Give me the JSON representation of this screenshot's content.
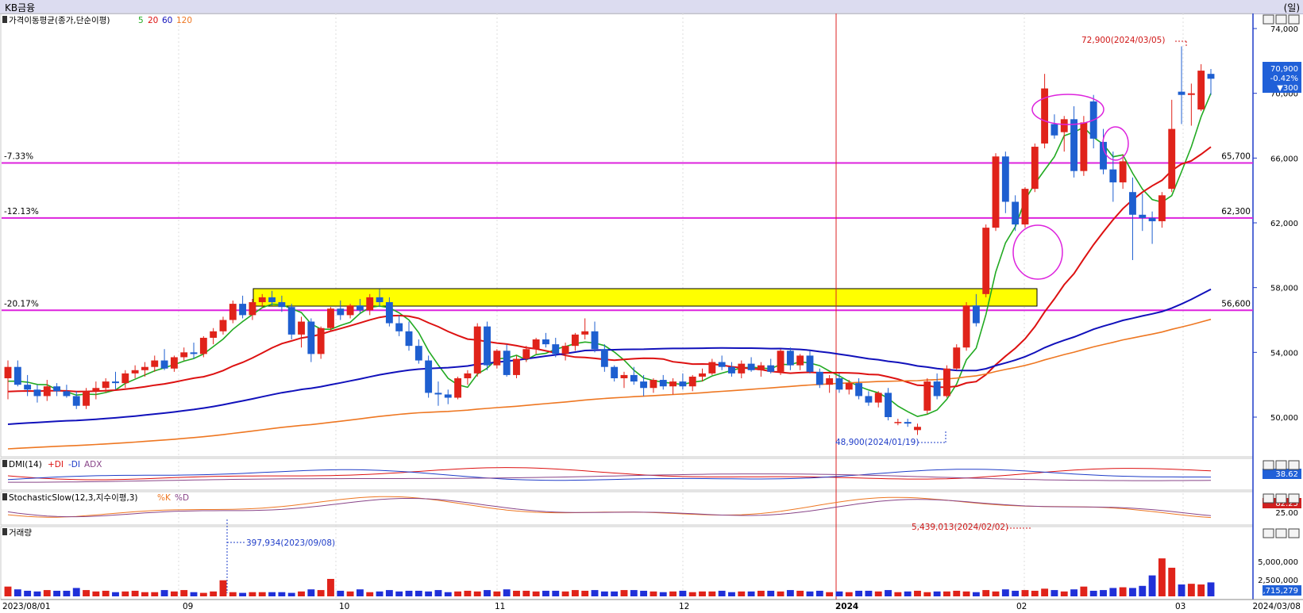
{
  "window": {
    "title": "KB금융",
    "unit_label": "(일)"
  },
  "panels": {
    "price": {
      "label": "가격이동평균(종가,단순이평)",
      "ma_labels": [
        "5",
        "20",
        "60",
        "120"
      ],
      "ma_colors": [
        "#22aa22",
        "#dd1111",
        "#1111bb",
        "#ee7722"
      ]
    },
    "dmi": {
      "label": "DMI(14)",
      "legend": [
        "+DI",
        "-DI",
        "ADX"
      ],
      "value": "38.62"
    },
    "stoch": {
      "label": "StochasticSlow(12,3,지수이평,3)",
      "legend": [
        "%K",
        "%D"
      ],
      "value": "82.25",
      "tick": "25.00"
    },
    "volume": {
      "label": "거래량",
      "ticks": [
        "5,000,000",
        "2,500,000"
      ],
      "value": "1,715,279",
      "annot_max": "5,439,013(2024/02/02)",
      "annot_prev": "397,934(2023/09/08)"
    }
  },
  "chart_data": {
    "type": "candlestick",
    "y_ticks": [
      "74,000",
      "70,000",
      "66,000",
      "62,000",
      "58,000",
      "54,000",
      "50,000"
    ],
    "ylim": [
      48000,
      75000
    ],
    "x_labels": [
      "2023/08/01",
      "09",
      "10",
      "11",
      "12",
      "2024",
      "02",
      "03",
      "2024/03/08"
    ],
    "price_tag": {
      "price": "70,900",
      "change": "-0.42%",
      "diff": "▼300"
    },
    "annotations": {
      "high": "72,900(2024/03/05)",
      "low": "48,900(2024/01/19)"
    },
    "levels": [
      {
        "pct": "-7.33%",
        "price_label": "65,700",
        "price": 65700
      },
      {
        "pct": "-12.13%",
        "price_label": "62,300",
        "price": 62300
      },
      {
        "pct": "-20.17%",
        "price_label": "56,600",
        "price": 56600
      }
    ],
    "series": [
      {
        "name": "5",
        "values": []
      },
      {
        "name": "20",
        "values": []
      },
      {
        "name": "60",
        "values": []
      },
      {
        "name": "120",
        "values": []
      }
    ],
    "candles": [
      [
        52400,
        53500,
        51100,
        53100
      ],
      [
        53100,
        53500,
        51900,
        52000
      ],
      [
        52000,
        52600,
        51300,
        51700
      ],
      [
        51700,
        52000,
        50900,
        51300
      ],
      [
        51300,
        52300,
        51000,
        51900
      ],
      [
        51900,
        52100,
        51300,
        51600
      ],
      [
        51600,
        52000,
        51200,
        51300
      ],
      [
        51300,
        51600,
        50500,
        50700
      ],
      [
        50700,
        51800,
        50500,
        51600
      ],
      [
        51600,
        52200,
        51100,
        51800
      ],
      [
        51800,
        52400,
        51500,
        52200
      ],
      [
        52200,
        52800,
        51700,
        52100
      ],
      [
        52100,
        52900,
        51800,
        52700
      ],
      [
        52700,
        53200,
        52400,
        52900
      ],
      [
        52900,
        53400,
        52500,
        53100
      ],
      [
        53100,
        53800,
        52800,
        53500
      ],
      [
        53500,
        54200,
        52900,
        53000
      ],
      [
        53000,
        53800,
        52800,
        53700
      ],
      [
        53700,
        54300,
        53500,
        54000
      ],
      [
        54000,
        54600,
        53600,
        53900
      ],
      [
        53900,
        55000,
        53700,
        54900
      ],
      [
        54900,
        55500,
        54500,
        55300
      ],
      [
        55300,
        56200,
        55100,
        56000
      ],
      [
        56000,
        57200,
        55800,
        57000
      ],
      [
        57000,
        57500,
        56100,
        56300
      ],
      [
        56300,
        57300,
        56000,
        57100
      ],
      [
        57100,
        57600,
        56800,
        57400
      ],
      [
        57400,
        57800,
        56900,
        57100
      ],
      [
        57100,
        57500,
        56500,
        56800
      ],
      [
        56800,
        57000,
        54800,
        55100
      ],
      [
        55100,
        56200,
        54300,
        55900
      ],
      [
        55900,
        56100,
        53400,
        53900
      ],
      [
        53900,
        55600,
        53600,
        55500
      ],
      [
        55500,
        56800,
        55300,
        56700
      ],
      [
        56700,
        57200,
        56000,
        56300
      ],
      [
        56300,
        57000,
        56100,
        56900
      ],
      [
        56900,
        57300,
        56400,
        56600
      ],
      [
        56600,
        57600,
        56300,
        57400
      ],
      [
        57400,
        57900,
        56800,
        57100
      ],
      [
        57100,
        57400,
        55600,
        55800
      ],
      [
        55800,
        56300,
        55000,
        55300
      ],
      [
        55300,
        55900,
        54100,
        54400
      ],
      [
        54400,
        54800,
        53300,
        53500
      ],
      [
        53500,
        53800,
        51200,
        51500
      ],
      [
        51500,
        52200,
        50700,
        51400
      ],
      [
        51400,
        51700,
        50800,
        51200
      ],
      [
        51200,
        52500,
        51100,
        52400
      ],
      [
        52400,
        52900,
        52000,
        52700
      ],
      [
        52700,
        55800,
        52500,
        55600
      ],
      [
        55600,
        55900,
        52900,
        53200
      ],
      [
        53200,
        54200,
        53000,
        54100
      ],
      [
        54100,
        54500,
        52500,
        52600
      ],
      [
        52600,
        53800,
        52400,
        53600
      ],
      [
        53600,
        54400,
        53400,
        54200
      ],
      [
        54200,
        54900,
        53900,
        54800
      ],
      [
        54800,
        55200,
        54300,
        54500
      ],
      [
        54500,
        54900,
        53700,
        53900
      ],
      [
        53900,
        54600,
        53500,
        54400
      ],
      [
        54400,
        55200,
        54100,
        55100
      ],
      [
        55100,
        56100,
        54800,
        55300
      ],
      [
        55300,
        55900,
        54000,
        54200
      ],
      [
        54200,
        54500,
        52800,
        53100
      ],
      [
        53100,
        53200,
        52200,
        52400
      ],
      [
        52400,
        52800,
        51800,
        52600
      ],
      [
        52600,
        53100,
        52000,
        52200
      ],
      [
        52200,
        52600,
        51300,
        51800
      ],
      [
        51800,
        52400,
        51500,
        52300
      ],
      [
        52300,
        52600,
        51700,
        51900
      ],
      [
        51900,
        52400,
        51400,
        52200
      ],
      [
        52200,
        52700,
        51700,
        51900
      ],
      [
        51900,
        52600,
        51600,
        52500
      ],
      [
        52500,
        53000,
        52200,
        52700
      ],
      [
        52700,
        53600,
        52600,
        53400
      ],
      [
        53400,
        53800,
        52900,
        53100
      ],
      [
        53100,
        53400,
        52500,
        52700
      ],
      [
        52700,
        53500,
        52400,
        53300
      ],
      [
        53300,
        53700,
        52800,
        52900
      ],
      [
        52900,
        53400,
        52500,
        53200
      ],
      [
        53200,
        53600,
        52700,
        52800
      ],
      [
        52800,
        54200,
        52600,
        54100
      ],
      [
        54100,
        54300,
        52900,
        53200
      ],
      [
        53200,
        53900,
        52900,
        53800
      ],
      [
        53800,
        54100,
        52700,
        52800
      ],
      [
        52800,
        53000,
        51800,
        52000
      ],
      [
        52000,
        52600,
        51500,
        52400
      ],
      [
        52400,
        52700,
        51500,
        51700
      ],
      [
        51700,
        52300,
        51400,
        52100
      ],
      [
        52100,
        52400,
        51100,
        51300
      ],
      [
        51300,
        51600,
        50700,
        50900
      ],
      [
        50900,
        51600,
        50600,
        51500
      ],
      [
        51500,
        51800,
        49800,
        50000
      ],
      [
        49700,
        49900,
        49500,
        49700
      ],
      [
        49700,
        49900,
        49400,
        49600
      ],
      [
        49200,
        49600,
        48900,
        49400
      ],
      [
        50400,
        52400,
        50200,
        52200
      ],
      [
        52200,
        52700,
        51100,
        51300
      ],
      [
        51300,
        53200,
        51200,
        53000
      ],
      [
        53000,
        54500,
        52900,
        54300
      ],
      [
        54300,
        57100,
        54100,
        56900
      ],
      [
        56900,
        57600,
        55600,
        55800
      ],
      [
        57600,
        61900,
        57400,
        61700
      ],
      [
        61700,
        66300,
        61500,
        66100
      ],
      [
        66100,
        66400,
        62600,
        63300
      ],
      [
        63300,
        63700,
        61500,
        61900
      ],
      [
        61900,
        64200,
        61700,
        64100
      ],
      [
        64100,
        66900,
        63900,
        66700
      ],
      [
        66900,
        71200,
        66600,
        70300
      ],
      [
        68100,
        68700,
        67200,
        67400
      ],
      [
        67600,
        68600,
        66400,
        68400
      ],
      [
        68400,
        69200,
        64800,
        65200
      ],
      [
        65200,
        68600,
        64900,
        68200
      ],
      [
        69500,
        69900,
        66600,
        67200
      ],
      [
        67000,
        67800,
        65000,
        65300
      ],
      [
        65300,
        66400,
        63300,
        64500
      ],
      [
        64500,
        66200,
        64100,
        65800
      ],
      [
        63900,
        64800,
        59700,
        62500
      ],
      [
        62500,
        63800,
        61500,
        62300
      ],
      [
        62300,
        62700,
        60700,
        62100
      ],
      [
        62100,
        63900,
        61700,
        63700
      ],
      [
        64100,
        69600,
        63900,
        67800
      ],
      [
        70100,
        72900,
        68100,
        69900
      ],
      [
        69900,
        70600,
        68000,
        70000
      ],
      [
        69000,
        71800,
        68900,
        71400
      ],
      [
        71200,
        71500,
        69900,
        70900
      ]
    ],
    "volume": [
      1.4,
      1.0,
      0.8,
      0.7,
      0.9,
      0.8,
      0.8,
      1.2,
      0.9,
      0.7,
      0.8,
      0.6,
      0.7,
      0.8,
      0.6,
      0.6,
      0.9,
      0.7,
      0.9,
      0.6,
      0.5,
      0.7,
      2.3,
      0.6,
      0.5,
      0.6,
      0.6,
      0.6,
      0.6,
      0.5,
      0.7,
      1.0,
      0.9,
      2.5,
      0.8,
      0.7,
      1.0,
      0.6,
      0.7,
      0.9,
      0.7,
      0.8,
      0.8,
      0.7,
      0.9,
      0.6,
      0.7,
      0.8,
      0.7,
      0.9,
      0.7,
      1.0,
      0.8,
      0.8,
      0.7,
      0.8,
      0.8,
      0.7,
      0.9,
      0.8,
      0.9,
      0.7,
      0.7,
      0.9,
      0.9,
      0.8,
      0.7,
      0.6,
      0.7,
      0.8,
      0.6,
      0.7,
      0.7,
      0.8,
      0.6,
      0.7,
      0.7,
      0.8,
      0.8,
      0.7,
      0.9,
      0.8,
      0.7,
      0.8,
      0.6,
      0.7,
      0.6,
      0.8,
      0.8,
      0.7,
      0.9,
      0.6,
      0.7,
      0.8,
      0.6,
      0.7,
      0.7,
      0.8,
      0.7,
      0.6,
      0.9,
      0.7,
      1.0,
      0.8,
      0.9,
      0.8,
      1.1,
      0.9,
      0.7,
      1.0,
      1.4,
      0.8,
      0.9,
      1.2,
      1.3,
      1.2,
      1.5,
      3.0,
      5.44,
      4.1,
      1.7,
      1.8,
      1.7,
      2.0,
      1.5,
      1.3,
      1.6,
      1.7,
      1.4,
      1.1,
      1.5,
      2.4,
      1.4,
      1.4,
      2.3,
      1.8,
      1.7,
      2.2,
      2.9,
      1.7,
      1.4,
      2.4,
      3.1,
      1.4,
      1.5
    ]
  }
}
